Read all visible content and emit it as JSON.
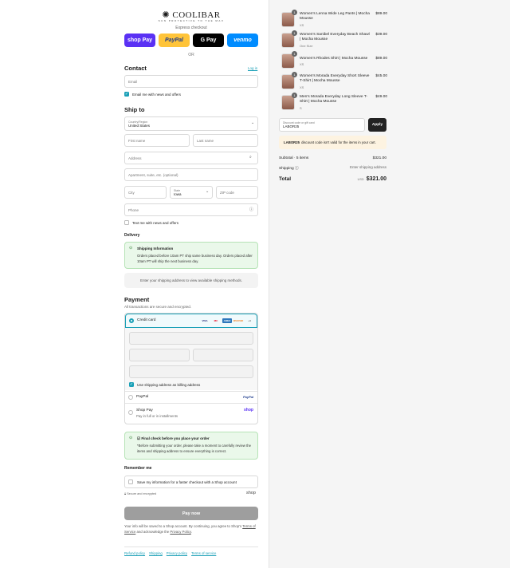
{
  "brand": {
    "name": "COOLIBAR",
    "tagline": "SUN PROTECTIVE TO THE MAX"
  },
  "express": {
    "label": "Express checkout",
    "buttons": [
      {
        "label": "shop Pay",
        "color": "#5a31f4"
      },
      {
        "label": "PayPal",
        "color": "#ffc439"
      },
      {
        "label": "G Pay",
        "color": "#000000"
      },
      {
        "label": "venmo",
        "color": "#008cff"
      }
    ],
    "or": "OR"
  },
  "contact": {
    "title": "Contact",
    "login": "Log in",
    "email_placeholder": "Email",
    "news_label": "Email me with news and offers"
  },
  "ship": {
    "title": "Ship to",
    "country_label": "Country/Region",
    "country_value": "United States",
    "first_name": "First name",
    "last_name": "Last name",
    "address": "Address",
    "apartment": "Apartment, suite, etc. (optional)",
    "city": "City",
    "state_label": "State",
    "state_value": "Iowa",
    "zip": "ZIP code",
    "phone": "Phone",
    "text_label": "Text me with news and offers"
  },
  "delivery": {
    "title": "Delivery",
    "info_title": "Shipping Information",
    "info_text": "Orders placed before 10am PT ship same business day. Orders placed after 10am PT will ship the next business day.",
    "methods_text": "Enter your shipping address to view available shipping methods."
  },
  "payment": {
    "title": "Payment",
    "subtitle": "All transactions are secure and encrypted.",
    "credit_card": "Credit card",
    "card_logos": [
      "VISA",
      "MC",
      "AMEX",
      "DISCOVER",
      "+4"
    ],
    "billing_label": "Use shipping address as billing address",
    "paypal": "PayPal",
    "paypal_logo": "PayPal",
    "shop_pay": "Shop Pay",
    "shop_pay_sub": "Pay in full or in installments",
    "shop_logo": "shop"
  },
  "final_check": {
    "title": "Final check before you place your order",
    "text": "*Before submitting your order, please take a moment to carefully review the items and shipping address to ensure everything is correct."
  },
  "remember": {
    "title": "Remember me",
    "save_label": "Save my information for a faster checkout with a Shop account",
    "secure": "Secure and encrypted",
    "shop_logo": "shop"
  },
  "pay_now": "Pay now",
  "legal": {
    "text_1": "Your info will be saved to a Shop account. By continuing, you agree to Shop's",
    "terms": "Terms of Service",
    "text_2": "and acknowledge the",
    "privacy": "Privacy Policy",
    "text_3": "."
  },
  "footer_links": [
    "Refund policy",
    "Shipping",
    "Privacy policy",
    "Terms of service"
  ],
  "cart": {
    "items": [
      {
        "qty": "1",
        "title": "Women's Lenna Wide Leg Pants | Mocha Mousse",
        "variant": "XS",
        "price": "$89.00"
      },
      {
        "qty": "1",
        "title": "Women's Sanibel Everyday Beach Shawl | Mocha Mousse",
        "variant": "One Size",
        "price": "$39.00"
      },
      {
        "qty": "1",
        "title": "Women's Rhodes Shirt | Mocha Mousse",
        "variant": "XS",
        "price": "$89.00"
      },
      {
        "qty": "1",
        "title": "Women's Morada Everyday Short Sleeve T-Shirt | Mocha Mousse",
        "variant": "XS",
        "price": "$45.00"
      },
      {
        "qty": "1",
        "title": "Men's Morada Everyday Long Sleeve T-Shirt | Mocha Mousse",
        "variant": "S",
        "price": "$49.00"
      }
    ],
    "discount_label": "Discount code or gift card",
    "discount_value": "LABOR25",
    "apply": "Apply",
    "warning_code": "LABOR25",
    "warning_text": "discount code isn't valid for the items in your cart.",
    "subtotal_label": "Subtotal · 5 items",
    "subtotal_value": "$321.00",
    "shipping_label": "Shipping",
    "shipping_value": "Enter shipping address",
    "total_label": "Total",
    "currency": "USD",
    "total_value": "$321.00"
  }
}
